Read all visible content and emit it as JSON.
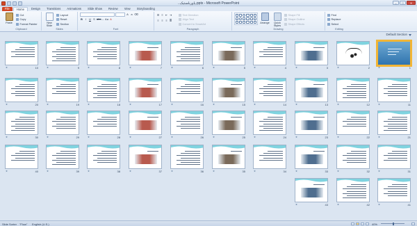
{
  "window": {
    "title": "..پاوربلستیک.pptx - Microsoft PowerPoint",
    "min": "–",
    "max": "□",
    "close": "✕"
  },
  "tabs": [
    "File",
    "Home",
    "Design",
    "Transitions",
    "Animations",
    "Slide Show",
    "Review",
    "View",
    "Storyboarding"
  ],
  "ribbon": {
    "clipboard": {
      "name": "Clipboard",
      "paste": "Paste",
      "cut": "Cut",
      "copy": "Copy",
      "format_painter": "Format Painter"
    },
    "slides": {
      "name": "Slides",
      "new_slide": "New Slide",
      "layout": "Layout",
      "reset": "Reset",
      "section": "Section"
    },
    "font": {
      "name": "Font",
      "font_value": "",
      "size_value": ""
    },
    "paragraph": {
      "name": "Paragraph",
      "text_direction": "Text Direction",
      "align_text": "Align Text",
      "smartart": "Convert to SmartArt"
    },
    "drawing": {
      "name": "Drawing",
      "arrange": "Arrange",
      "quick_styles": "Quick Styles",
      "shape_fill": "Shape Fill",
      "shape_outline": "Shape Outline",
      "shape_effects": "Shape Effects"
    },
    "editing": {
      "name": "Editing",
      "find": "Find",
      "replace": "Replace",
      "select": "Select"
    }
  },
  "section": {
    "name": "Default Section"
  },
  "slides": [
    {
      "n": "1"
    },
    {
      "n": "2"
    },
    {
      "n": "3"
    },
    {
      "n": "4"
    },
    {
      "n": "5"
    },
    {
      "n": "6"
    },
    {
      "n": "7"
    },
    {
      "n": "8"
    },
    {
      "n": "9"
    },
    {
      "n": "10"
    },
    {
      "n": "11"
    },
    {
      "n": "12"
    },
    {
      "n": "13"
    },
    {
      "n": "14"
    },
    {
      "n": "15"
    },
    {
      "n": "16"
    },
    {
      "n": "17"
    },
    {
      "n": "18"
    },
    {
      "n": "19"
    },
    {
      "n": "20"
    },
    {
      "n": "21"
    },
    {
      "n": "22"
    },
    {
      "n": "23"
    },
    {
      "n": "24"
    },
    {
      "n": "25"
    },
    {
      "n": "26"
    },
    {
      "n": "27"
    },
    {
      "n": "28"
    },
    {
      "n": "29"
    },
    {
      "n": "30"
    },
    {
      "n": "31"
    },
    {
      "n": "32"
    },
    {
      "n": "33"
    },
    {
      "n": "34"
    },
    {
      "n": "35"
    },
    {
      "n": "36"
    },
    {
      "n": "37"
    },
    {
      "n": "38"
    },
    {
      "n": "39"
    },
    {
      "n": "40"
    },
    {
      "n": "41"
    },
    {
      "n": "42"
    },
    {
      "n": "43"
    }
  ],
  "status": {
    "view": "Slide Sorter",
    "theme": "\"Flow\"",
    "language": "English (U.S.)",
    "zoom": "40%"
  },
  "colors": {
    "accent": "#f2b535",
    "file_tab": "#d24726",
    "wave": "#7fd3df"
  }
}
